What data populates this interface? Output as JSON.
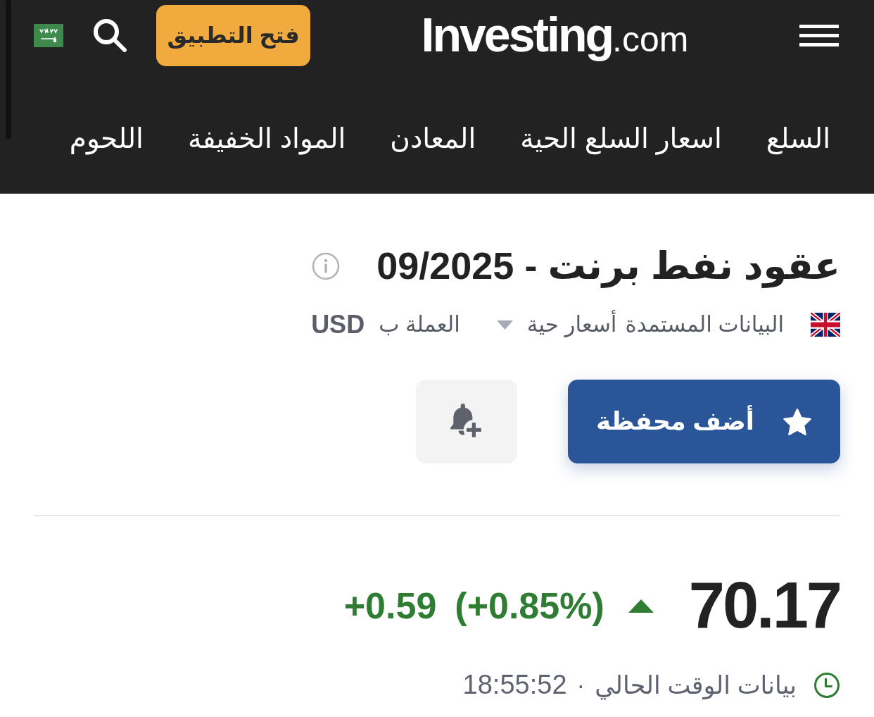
{
  "header": {
    "logo": {
      "name": "Investing",
      "suffix": ".com"
    },
    "open_app_button": "فتح التطبيق"
  },
  "nav": [
    {
      "label": "السلع"
    },
    {
      "label": "اسعار السلع الحية"
    },
    {
      "label": "المعادن"
    },
    {
      "label": "المواد الخفيفة"
    },
    {
      "label": "اللحوم"
    }
  ],
  "instrument": {
    "title": "عقود نفط برنت - 09/2025",
    "data_source_label": "البيانات المستمدة",
    "data_source": "أسعار حية",
    "currency_label": "العملة ب",
    "currency": "USD"
  },
  "actions": {
    "watchlist_button": "أضف محفظة"
  },
  "quote": {
    "last": "70.17",
    "up": true,
    "change": "+0.59",
    "change_percent": "(+0.85%)",
    "status": "بيانات الوقت الحالي",
    "separator": "·",
    "time": "18:55:52"
  }
}
